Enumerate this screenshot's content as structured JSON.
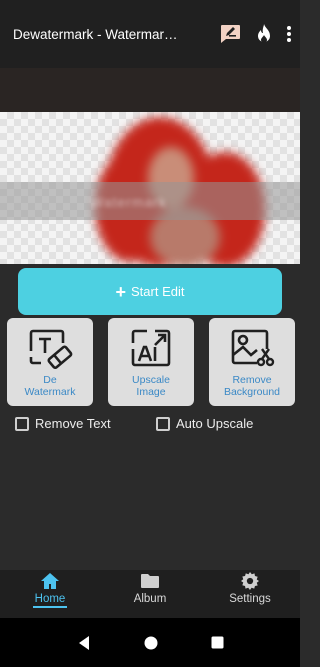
{
  "appbar": {
    "title": "Dewatermark - Watermark Remover",
    "icons": [
      "edit-note-icon",
      "fire-icon",
      "more-vert-icon"
    ]
  },
  "preview": {
    "watermark_text": "Watermark"
  },
  "start_edit": {
    "label": "Start Edit"
  },
  "tools": [
    {
      "label": "De\nWatermark",
      "icon": "text-eraser-icon"
    },
    {
      "label": "Upscale\nImage",
      "icon": "ai-upscale-icon"
    },
    {
      "label": "Remove\nBackground",
      "icon": "image-scissors-icon"
    }
  ],
  "options": {
    "remove_text": "Remove Text",
    "auto_upscale": "Auto Upscale"
  },
  "bottom_nav": [
    {
      "label": "Home",
      "icon": "home-icon",
      "active": true
    },
    {
      "label": "Album",
      "icon": "folder-icon",
      "active": false
    },
    {
      "label": "Settings",
      "icon": "settings-icon",
      "active": false
    }
  ],
  "colors": {
    "accent": "#4dd0e1",
    "tool_label": "#3b89c6",
    "active_nav": "#4dc3f0",
    "background": "#2b2b2b"
  }
}
